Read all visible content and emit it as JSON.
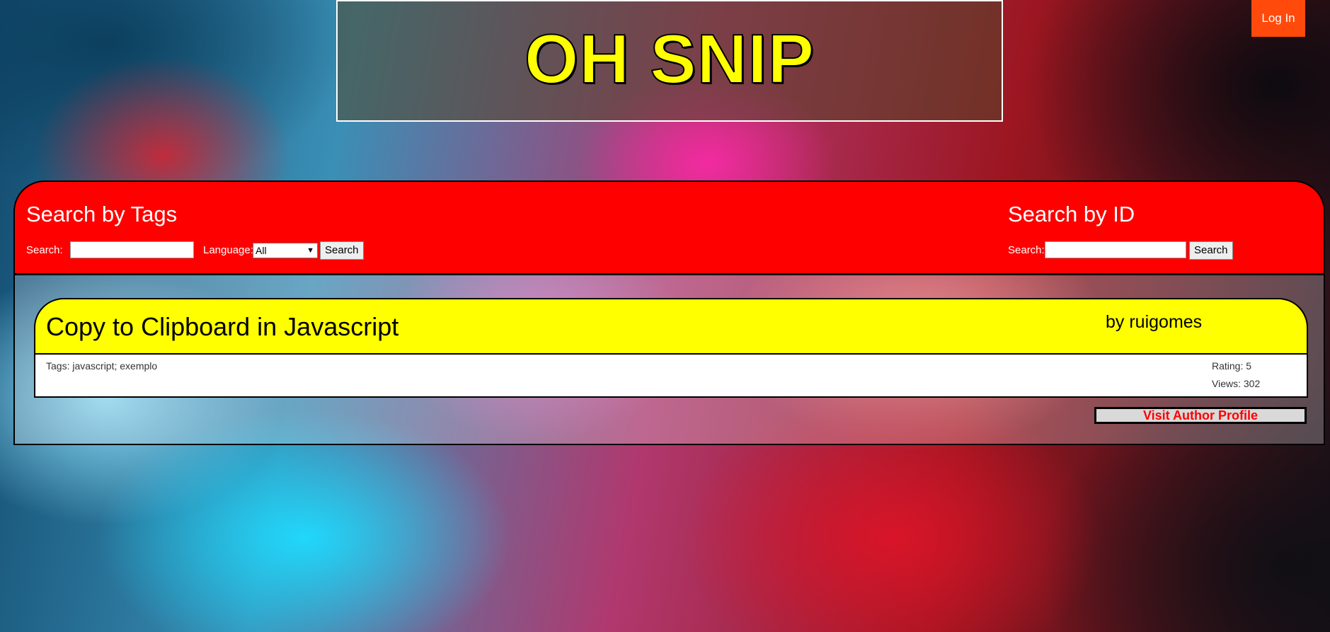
{
  "header": {
    "site_title": "OH SNIP",
    "login_label": "Log In"
  },
  "tag_search": {
    "heading": "Search by Tags",
    "search_label": "Search:",
    "search_value": "",
    "language_label": "Language:",
    "language_selected": "All",
    "button_label": "Search"
  },
  "id_search": {
    "heading": "Search by ID",
    "search_label": "Search:",
    "search_value": "",
    "button_label": "Search"
  },
  "snippet": {
    "title": "Copy to Clipboard in Javascript",
    "author": "by ruigomes",
    "tags": "Tags: javascript; exemplo",
    "rating": "Rating: 5",
    "views": "Views: 302",
    "profile_link": "Visit Author Profile"
  },
  "colors": {
    "accent_red": "#ff0000",
    "title_yellow": "#ffff00",
    "login_orange": "#ff4a0c"
  }
}
